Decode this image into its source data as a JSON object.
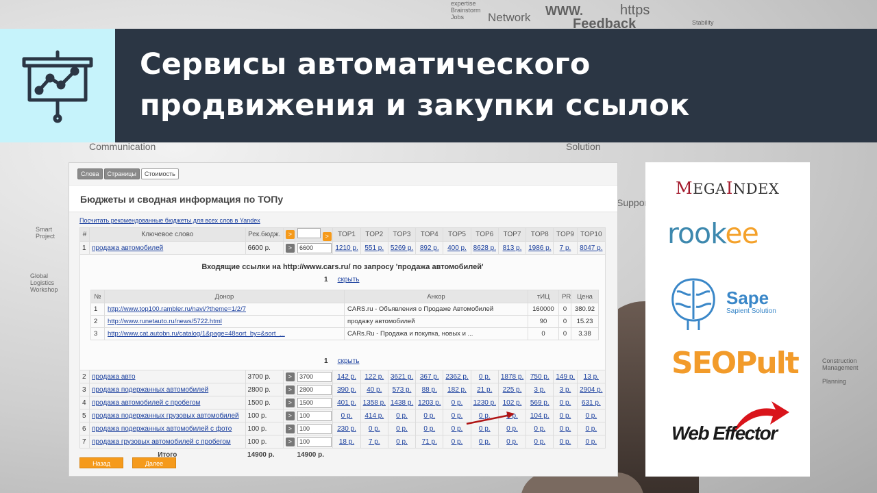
{
  "header": {
    "title_line1": "Сервисы автоматического",
    "title_line2": "продвижения и закупки ссылок",
    "icon": "presentation-chart-icon"
  },
  "background": {
    "words": [
      "Network",
      "WWW.",
      "https",
      "Feedback",
      "Communication",
      "Solution",
      "Support",
      "Global",
      "Logistics",
      "Workshop",
      "Smart",
      "Project",
      "Construction",
      "Management",
      "Planning",
      "expertise",
      "Brainstorm",
      "Jobs",
      "Stability"
    ]
  },
  "panel": {
    "tabs": [
      "Слова",
      "Страницы",
      "Стоимость"
    ],
    "title": "Бюджеты и сводная информация по ТОПу",
    "recommend_link": "Посчитать рекомендованные бюджеты для всех слов в Yandex",
    "columns": [
      "#",
      "Ключевое слово",
      "Рек.бюдж.",
      "TOP1",
      "TOP2",
      "TOP3",
      "TOP4",
      "TOP5",
      "TOP6",
      "TOP7",
      "TOP8",
      "TOP9",
      "TOP10"
    ],
    "header_button": ">",
    "rows": [
      {
        "n": "1",
        "keyword": "продажа автомобилей",
        "budget": "6600 р.",
        "input": "6600",
        "tops": [
          "1210 р.",
          "551 р.",
          "5269 р.",
          "892 р.",
          "400 р.",
          "8628 р.",
          "813 р.",
          "1986 р.",
          "7 р.",
          "8047 р."
        ]
      },
      {
        "n": "2",
        "keyword": "продажа авто",
        "budget": "3700 р.",
        "input": "3700",
        "tops": [
          "142 р.",
          "122 р.",
          "3621 р.",
          "367 р.",
          "2362 р.",
          "0 р.",
          "1878 р.",
          "750 р.",
          "149 р.",
          "13 р."
        ]
      },
      {
        "n": "3",
        "keyword": "продажа подержанных автомобилей",
        "budget": "2800 р.",
        "input": "2800",
        "tops": [
          "390 р.",
          "40 р.",
          "573 р.",
          "88 р.",
          "182 р.",
          "21 р.",
          "225 р.",
          "3 р.",
          "3 р.",
          "2904 р."
        ]
      },
      {
        "n": "4",
        "keyword": "продажа автомобилей с пробегом",
        "budget": "1500 р.",
        "input": "1500",
        "tops": [
          "401 р.",
          "1358 р.",
          "1438 р.",
          "1203 р.",
          "0 р.",
          "1230 р.",
          "102 р.",
          "569 р.",
          "0 р.",
          "631 р."
        ]
      },
      {
        "n": "5",
        "keyword": "продажа подержанных грузовых автомобилей",
        "budget": "100 р.",
        "input": "100",
        "tops": [
          "0 р.",
          "414 р.",
          "0 р.",
          "0 р.",
          "0 р.",
          "0 р.",
          "0 р.",
          "104 р.",
          "0 р.",
          "0 р."
        ]
      },
      {
        "n": "6",
        "keyword": "продажа подержанных автомобилей с фото",
        "budget": "100 р.",
        "input": "100",
        "tops": [
          "230 р.",
          "0 р.",
          "0 р.",
          "0 р.",
          "0 р.",
          "0 р.",
          "0 р.",
          "0 р.",
          "0 р.",
          "0 р."
        ]
      },
      {
        "n": "7",
        "keyword": "продажа грузовых автомобилей с пробегом",
        "budget": "100 р.",
        "input": "100",
        "tops": [
          "18 р.",
          "7 р.",
          "0 р.",
          "71 р.",
          "0 р.",
          "0 р.",
          "0 р.",
          "0 р.",
          "0 р.",
          "0 р."
        ]
      }
    ],
    "total_label": "Итого",
    "total_budget": "14900 р.",
    "total_input": "14900 р.",
    "incoming": {
      "title": "Входящие ссылки на http://www.cars.ru/  по запросу 'продажа автомобилей'",
      "page": "1",
      "hide_label": "скрыть",
      "columns": [
        "№",
        "Донор",
        "Анкор",
        "тИЦ",
        "PR",
        "Цена"
      ],
      "rows": [
        {
          "n": "1",
          "donor": "http://www.top100.rambler.ru/navi/?theme=1/2/7",
          "anchor": "CARS.ru - Объявления о Продаже Автомобилей",
          "tic": "160000",
          "pr": "0",
          "price": "380.92"
        },
        {
          "n": "2",
          "donor": "http://www.runetauto.ru/news/5722.html",
          "anchor": "продажу автомобилей",
          "tic": "90",
          "pr": "0",
          "price": "15.23"
        },
        {
          "n": "3",
          "donor": "http://www.cat.autobn.ru/catalog/1&page=48sort_by=&sort_...",
          "anchor": "CARs.Ru - Продажа и покупка, новых и ...",
          "tic": "0",
          "pr": "0",
          "price": "3.38"
        }
      ]
    },
    "back_button": "Назад",
    "next_button": "Далее",
    "accent_color": "#f59a1b"
  },
  "logos": {
    "megaindex_first": "M",
    "megaindex_rest": "EGA",
    "megaindex_second": "I",
    "megaindex_rest2": "NDEX",
    "rookee_part1": "rook",
    "rookee_part2": "ee",
    "sape_name": "Sape",
    "sape_sub": "Sapient Solution",
    "seopult": "SEOPult",
    "webeffector": "Web Effector"
  }
}
